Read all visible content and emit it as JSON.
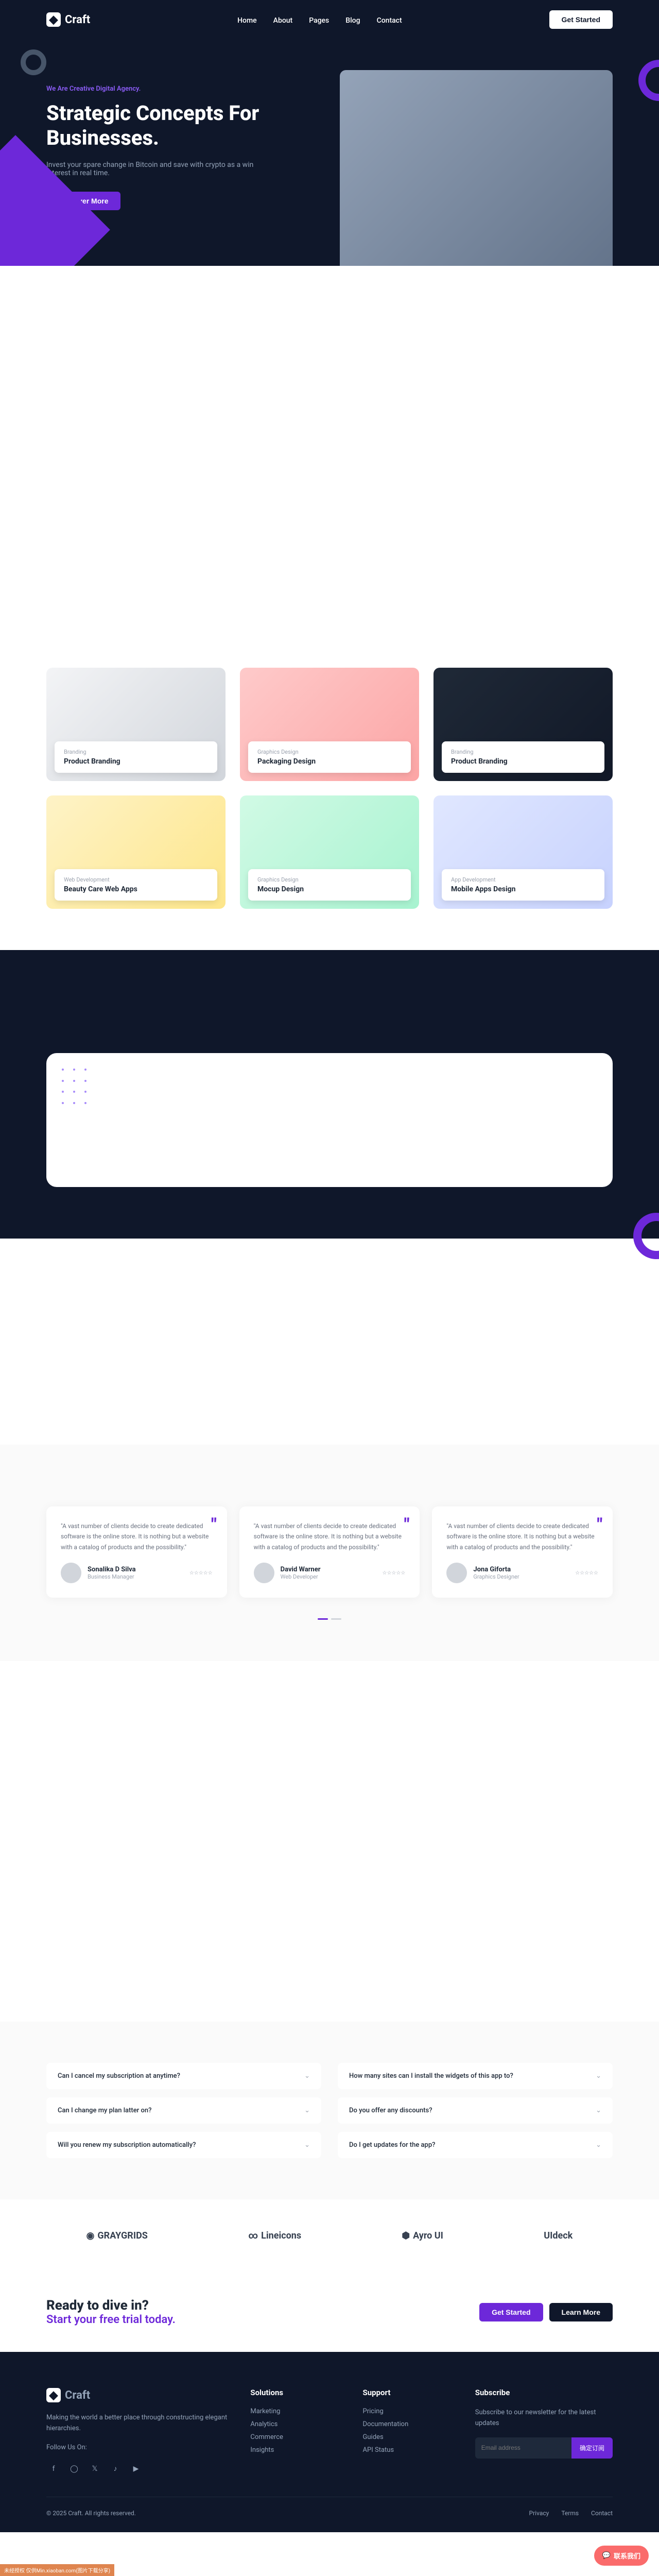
{
  "brand": "Craft",
  "nav": {
    "items": [
      "Home",
      "About",
      "Pages",
      "Blog",
      "Contact"
    ],
    "cta": "Get Started"
  },
  "hero": {
    "tag": "We Are Creative Digital Agency.",
    "title": "Strategic Concepts For Businesses.",
    "desc": "Invest your spare change in Bitcoin and save with crypto as a win interest in real time.",
    "btn": "Discover More"
  },
  "portfolio": [
    {
      "cat": "Branding",
      "title": "Product Branding"
    },
    {
      "cat": "Graphics Design",
      "title": "Packaging Design"
    },
    {
      "cat": "Branding",
      "title": "Product Branding"
    },
    {
      "cat": "Web Development",
      "title": "Beauty Care Web Apps"
    },
    {
      "cat": "Graphics Design",
      "title": "Mocup Design"
    },
    {
      "cat": "App Development",
      "title": "Mobile Apps Design"
    }
  ],
  "testimonials": [
    {
      "text": "\"A vast number of clients decide to create dedicated software is the online store. It is nothing but a website with a catalog of products and the possibility.\"",
      "name": "Sonalika D Silva",
      "role": "Business Manager"
    },
    {
      "text": "\"A vast number of clients decide to create dedicated software is the online store. It is nothing but a website with a catalog of products and the possibility.\"",
      "name": "David Warner",
      "role": "Web Developer"
    },
    {
      "text": "\"A vast number of clients decide to create dedicated software is the online store. It is nothing but a website with a catalog of products and the possibility.\"",
      "name": "Jona Giforta",
      "role": "Graphics Designer"
    }
  ],
  "faq": [
    "Can I cancel my subscription at anytime?",
    "How many sites can I install the widgets of this app to?",
    "Can I change my plan latter on?",
    "Do you offer any discounts?",
    "Will you renew my subscription automatically?",
    "Do I get updates for the app?"
  ],
  "brands": [
    "GRAYGRIDS",
    "Lineicons",
    "Ayro UI",
    "UIdeck"
  ],
  "ctaBanner": {
    "title": "Ready to dive in?",
    "sub": "Start your free trial today.",
    "b1": "Get Started",
    "b2": "Learn More"
  },
  "footer": {
    "about": "Making the world a better place through constructing elegant hierarchies.",
    "followLabel": "Follow Us On:",
    "cols": [
      {
        "title": "Solutions",
        "links": [
          "Marketing",
          "Analytics",
          "Commerce",
          "Insights"
        ]
      },
      {
        "title": "Support",
        "links": [
          "Pricing",
          "Documentation",
          "Guides",
          "API Status"
        ]
      }
    ],
    "subscribe": {
      "title": "Subscribe",
      "desc": "Subscribe to our newsletter for the latest updates",
      "placeholder": "Email address",
      "btn": "确定订阅"
    },
    "copyright": "© 2025 Craft. All rights reserved.",
    "bottomLinks": [
      "Privacy",
      "Terms",
      "Contact"
    ]
  },
  "chat": "联系我们",
  "watermark": "未经授权 仅供Min.xiaoban.com(图片下载分享)"
}
